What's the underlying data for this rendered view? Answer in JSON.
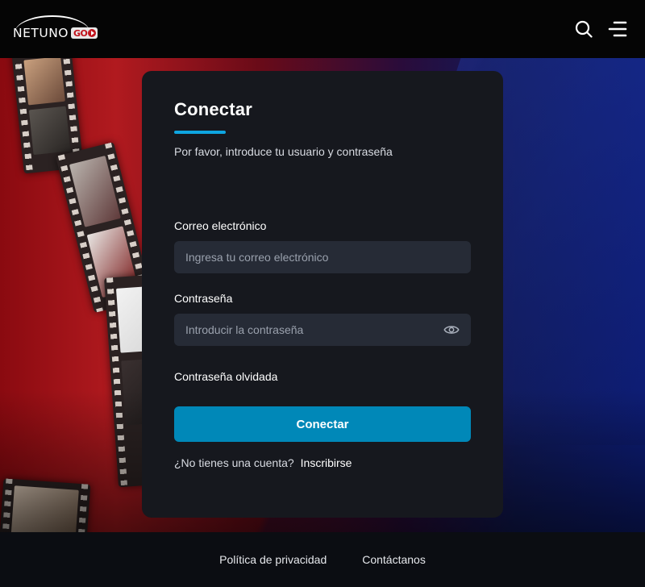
{
  "header": {
    "logo_text": "NETUNO",
    "logo_badge": "GO",
    "search_icon": "search-icon",
    "menu_icon": "hamburger-menu-icon"
  },
  "login": {
    "title": "Conectar",
    "subtitle": "Por favor, introduce tu usuario y contraseña",
    "email_label": "Correo electrónico",
    "email_placeholder": "Ingresa tu correo electrónico",
    "email_value": "",
    "password_label": "Contraseña",
    "password_placeholder": "Introducir la contraseña",
    "password_value": "",
    "password_toggle_icon": "eye-icon",
    "forgot_label": "Contraseña olvidada",
    "submit_label": "Conectar",
    "no_account_text": "¿No tienes una cuenta?",
    "signup_label": "Inscribirse"
  },
  "footer": {
    "links": [
      "Política de privacidad",
      "Contáctanos"
    ]
  },
  "colors": {
    "accent": "#0088b8",
    "title_underline": "#0ea5e0",
    "card_bg": "#16181e",
    "input_bg": "#262b36",
    "brand_red": "#c0121b"
  }
}
